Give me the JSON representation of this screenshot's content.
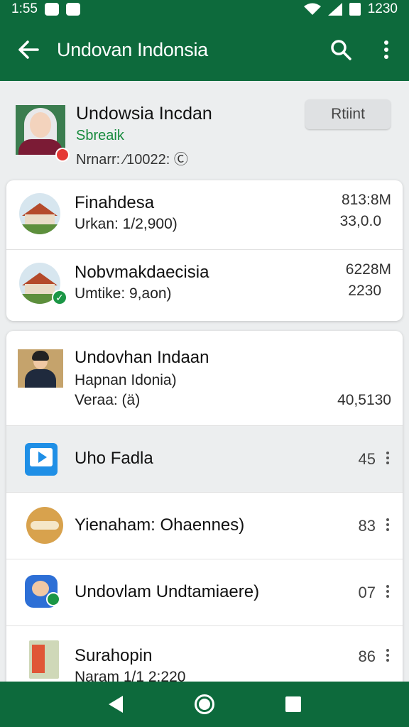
{
  "status_bar": {
    "time": "1:55",
    "clock": "1230"
  },
  "app_bar": {
    "title": "Undovan Indonsia"
  },
  "header": {
    "name": "Undowsia Incdan",
    "subtitle": "Sbreaik",
    "meta": "Nrnarr: ∕10022: Ⓒ",
    "status_button": "Rtiint"
  },
  "card1": [
    {
      "title": "Finahdesa",
      "subtitle": "Urkan: 1/2,900)",
      "value1": "813:8M",
      "value2": "33,0.0"
    },
    {
      "title": "Nobvmakdaecisia",
      "subtitle": "Umtike: 9,aon)",
      "value1": "6228M",
      "value2": "2230"
    }
  ],
  "profile": {
    "title": "Undovhan Indaan",
    "line1": "Hapnan Idonia)",
    "line2": "Veraa: (ä)",
    "value": "40,5130"
  },
  "list": [
    {
      "title": "Uho Fadla",
      "count": "45"
    },
    {
      "title": "Yienaham: Ohaennes)",
      "count": "83"
    },
    {
      "title": "Undovlam Undtamiaere)",
      "count": "07"
    },
    {
      "title": "Surahopin",
      "subtitle": "Naram 1/1 2:220",
      "count": "86"
    }
  ],
  "colors": {
    "primary": "#0d6a3c",
    "accent_green": "#168a3c",
    "live_red": "#e53935"
  }
}
